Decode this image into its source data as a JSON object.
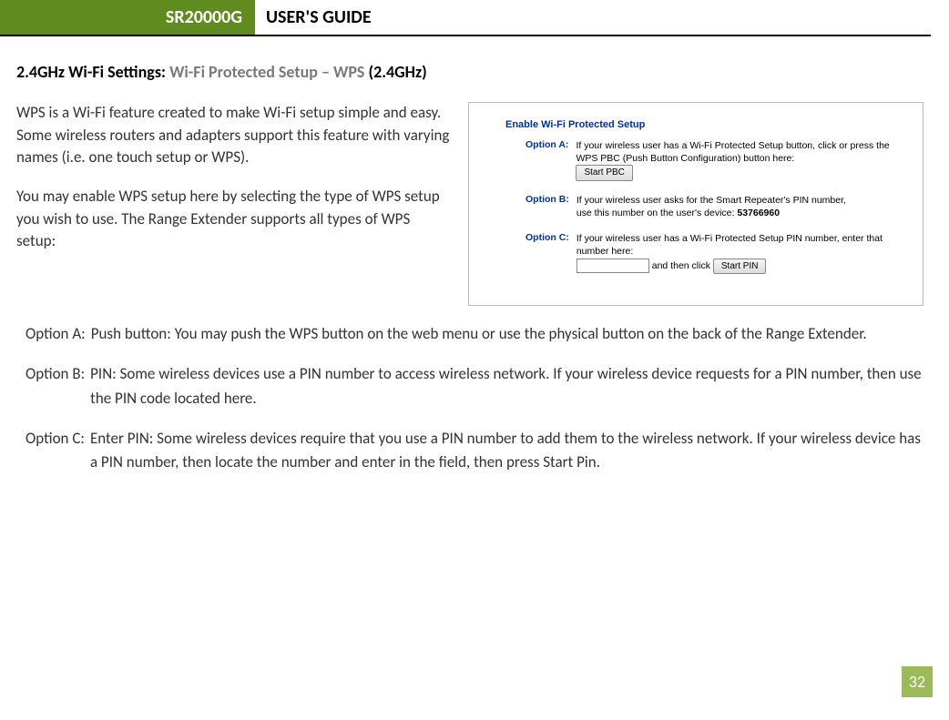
{
  "header": {
    "model": "SR20000G",
    "title": "USER'S GUIDE"
  },
  "section": {
    "prefix": "2.4GHz Wi-Fi Settings: ",
    "gray": "Wi-Fi Protected Setup – WPS ",
    "suffix": "(2.4GHz)"
  },
  "intro": {
    "p1": "WPS is a Wi-Fi feature created to make Wi-Fi setup simple and easy. Some wireless routers and adapters support this feature with varying names (i.e. one touch setup or WPS).",
    "p2": "You may enable WPS setup here by selecting the type of WPS setup you wish to use. The Range Extender supports all types of WPS setup:"
  },
  "panel": {
    "title": "Enable Wi-Fi Protected Setup",
    "optA": {
      "label": "Option A:",
      "text": "If your wireless user has a Wi-Fi Protected Setup button, click or press the WPS PBC (Push Button Configuration) button here:",
      "button": "Start PBC"
    },
    "optB": {
      "label": "Option B:",
      "line1": "If your wireless user asks for the Smart Repeater's PIN number,",
      "line2_prefix": "use this number on the user's device:  ",
      "pin": "53766960"
    },
    "optC": {
      "label": "Option C:",
      "text": "If your wireless user has a Wi-Fi Protected Setup PIN number, enter that number here:",
      "mid": " and then click ",
      "button": "Start PIN"
    }
  },
  "options": {
    "a": {
      "label": "Option A:",
      "text": "Push button: You may push the WPS button on the web menu or use the physical button on the back of the Range Extender."
    },
    "b": {
      "label": "Option B:",
      "text": "PIN: Some wireless devices use a PIN number to access wireless network. If your wireless device requests for a PIN number, then use the PIN code located here."
    },
    "c": {
      "label": "Option C:",
      "text": "Enter PIN: Some wireless devices require that you use a PIN number to add them to the wireless network. If your wireless device has a PIN number, then locate the number and enter in the field, then press Start Pin."
    }
  },
  "page_number": "32"
}
